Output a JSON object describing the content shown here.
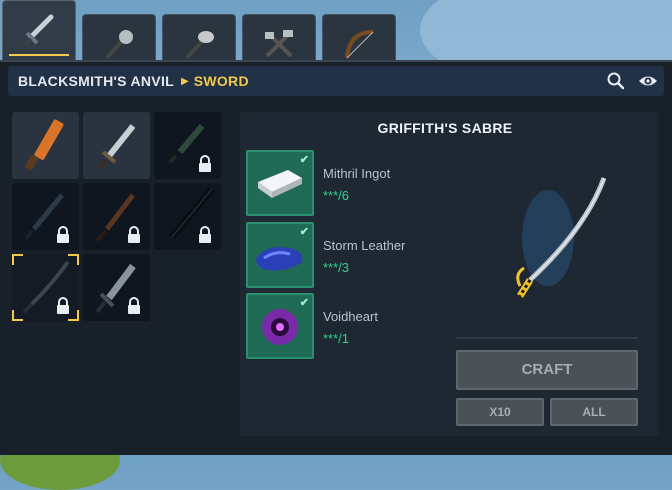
{
  "tabs": [
    {
      "icon": "sword-icon",
      "active": true
    },
    {
      "icon": "mace-icon",
      "active": false
    },
    {
      "icon": "battle-axe-icon",
      "active": false
    },
    {
      "icon": "crossed-hammers-icon",
      "active": false
    },
    {
      "icon": "bow-icon",
      "active": false
    }
  ],
  "header": {
    "breadcrumb_root": "BLACKSMITH'S ANVIL",
    "breadcrumb_current": "SWORD",
    "icons": [
      "search-icon",
      "eye-icon"
    ]
  },
  "items": [
    {
      "name": "orange-blade",
      "locked": false,
      "selected": false
    },
    {
      "name": "steel-sword",
      "locked": false,
      "selected": false
    },
    {
      "name": "jade-dagger",
      "locked": true,
      "selected": false
    },
    {
      "name": "dark-rapier",
      "locked": true,
      "selected": false
    },
    {
      "name": "bronze-sword",
      "locked": true,
      "selected": false
    },
    {
      "name": "greatsword",
      "locked": true,
      "selected": false
    },
    {
      "name": "griffiths-sabre",
      "locked": true,
      "selected": true
    },
    {
      "name": "broad-sword",
      "locked": true,
      "selected": false
    }
  ],
  "detail": {
    "title": "GRIFFITH'S SABRE",
    "ingredients": [
      {
        "name": "Mithril Ingot",
        "qty": "***/6",
        "icon": "mithril-ingot-icon",
        "met": true
      },
      {
        "name": "Storm Leather",
        "qty": "***/3",
        "icon": "storm-leather-icon",
        "met": true
      },
      {
        "name": "Voidheart",
        "qty": "***/1",
        "icon": "voidheart-icon",
        "met": true
      }
    ],
    "craft_label": "CRAFT",
    "x10_label": "X10",
    "all_label": "ALL"
  },
  "colors": {
    "accent": "#f2c94c",
    "ok": "#35d18b",
    "panel": "#18202a"
  }
}
